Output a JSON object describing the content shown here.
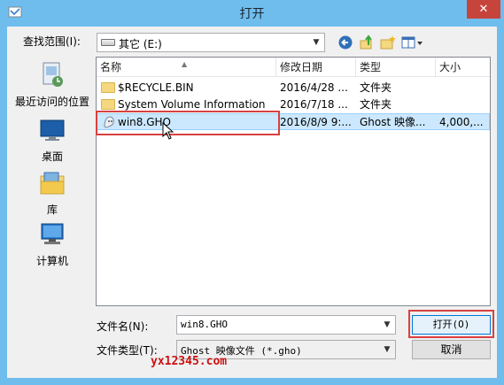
{
  "window": {
    "title": "打开",
    "close": "✕"
  },
  "lookin": {
    "label": "查找范围(I):",
    "value": "其它 (E:)"
  },
  "places": [
    {
      "label": "最近访问的位置",
      "icon": "recent-places-icon"
    },
    {
      "label": "桌面",
      "icon": "desktop-icon"
    },
    {
      "label": "库",
      "icon": "libraries-icon"
    },
    {
      "label": "计算机",
      "icon": "computer-icon"
    }
  ],
  "columns": {
    "name": "名称",
    "date": "修改日期",
    "type": "类型",
    "size": "大小"
  },
  "files": [
    {
      "name": "$RECYCLE.BIN",
      "date": "2016/4/28 ...",
      "type": "文件夹",
      "size": "",
      "icon": "folder-icon"
    },
    {
      "name": "System Volume Information",
      "date": "2016/7/18 ...",
      "type": "文件夹",
      "size": "",
      "icon": "folder-icon"
    },
    {
      "name": "win8.GHO",
      "date": "2016/8/9 9:...",
      "type": "Ghost 映像...",
      "size": "4,000,...",
      "icon": "ghost-image-icon",
      "selected": true
    }
  ],
  "filename": {
    "label": "文件名(N):",
    "value": "win8.GHO"
  },
  "filetype": {
    "label": "文件类型(T):",
    "value": "Ghost 映像文件 (*.gho)"
  },
  "buttons": {
    "open": "打开(O)",
    "cancel": "取消"
  },
  "watermark": "yx12345.com",
  "colors": {
    "titlebar": "#6fbdec",
    "selection": "#cce8ff",
    "highlight": "#d94040",
    "close": "#c7443c"
  }
}
